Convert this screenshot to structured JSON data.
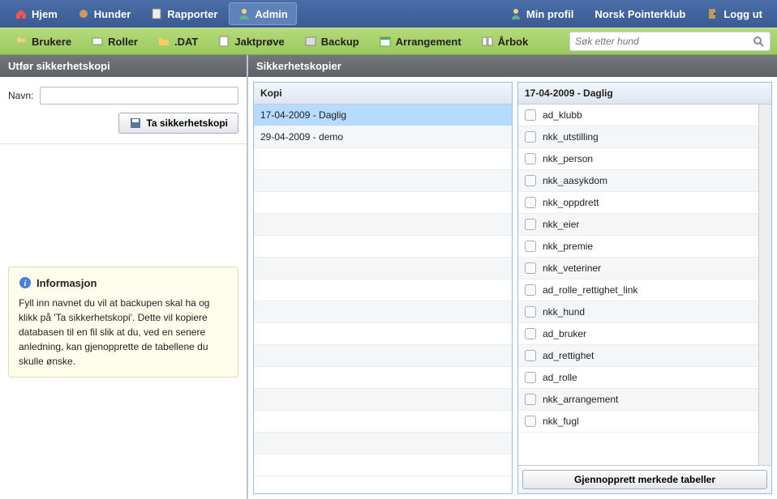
{
  "topnav": {
    "items": [
      {
        "label": "Hjem",
        "icon": "home"
      },
      {
        "label": "Hunder",
        "icon": "dog"
      },
      {
        "label": "Rapporter",
        "icon": "report"
      },
      {
        "label": "Admin",
        "icon": "user-admin",
        "active": true
      }
    ],
    "right": {
      "profile": "Min profil",
      "club": "Norsk Pointerklub",
      "logout": "Logg ut"
    }
  },
  "subnav": {
    "items": [
      {
        "label": "Brukere"
      },
      {
        "label": "Roller"
      },
      {
        "label": ".DAT"
      },
      {
        "label": "Jaktprøve"
      },
      {
        "label": "Backup"
      },
      {
        "label": "Arrangement"
      },
      {
        "label": "Årbok"
      }
    ],
    "search_placeholder": "Søk etter hund"
  },
  "left_panel": {
    "title": "Utfør sikkerhetskopi",
    "name_label": "Navn:",
    "name_value": "",
    "button": "Ta sikkerhetskopi"
  },
  "info": {
    "title": "Informasjon",
    "body": "Fyll inn navnet du vil at backupen skal ha og klikk på 'Ta sikkerhetskopi'. Dette vil kopiere databasen til en fil slik at du, ved en senere anledning, kan gjenopprette de tabellene du skulle ønske."
  },
  "right_panel": {
    "title": "Sikkerhetskopier",
    "copies_header": "Kopi",
    "copies": [
      {
        "label": "17-04-2009 - Daglig",
        "selected": true
      },
      {
        "label": "29-04-2009 - demo"
      }
    ],
    "detail_header": "17-04-2009 - Daglig",
    "tables": [
      "ad_klubb",
      "nkk_utstilling",
      "nkk_person",
      "nkk_aasykdom",
      "nkk_oppdrett",
      "nkk_eier",
      "nkk_premie",
      "nkk_veteriner",
      "ad_rolle_rettighet_link",
      "nkk_hund",
      "ad_bruker",
      "ad_rettighet",
      "ad_rolle",
      "nkk_arrangement",
      "nkk_fugl"
    ],
    "restore_button": "Gjennopprett merkede tabeller"
  }
}
